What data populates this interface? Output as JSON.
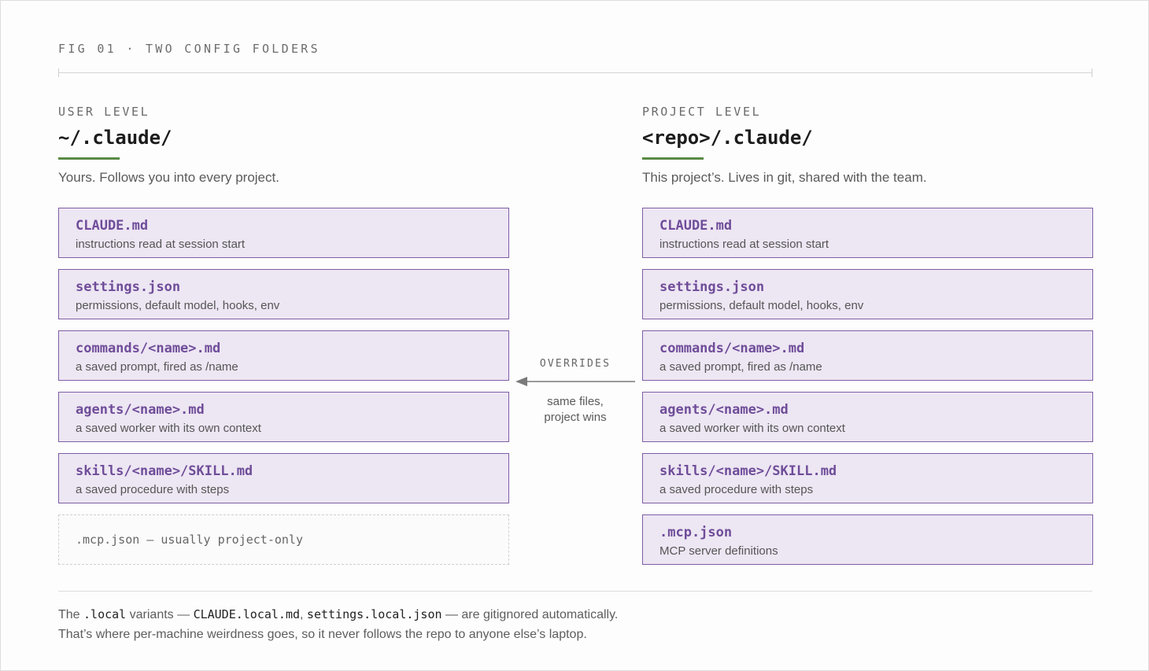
{
  "header": {
    "title": "FIG 01 · TWO CONFIG FOLDERS"
  },
  "user": {
    "label": "USER LEVEL",
    "path": "~/.claude/",
    "description": "Yours. Follows you into every project.",
    "files": [
      {
        "name": "CLAUDE.md",
        "desc": "instructions read at session start"
      },
      {
        "name": "settings.json",
        "desc": "permissions, default model, hooks, env"
      },
      {
        "name": "commands/<name>.md",
        "desc": "a saved prompt, fired as /name"
      },
      {
        "name": "agents/<name>.md",
        "desc": "a saved worker with its own context"
      },
      {
        "name": "skills/<name>/SKILL.md",
        "desc": "a saved procedure with steps"
      }
    ],
    "placeholder": ".mcp.json — usually project-only"
  },
  "project": {
    "label": "PROJECT LEVEL",
    "path": "<repo>/.claude/",
    "description": "This project’s. Lives in git, shared with the team.",
    "files": [
      {
        "name": "CLAUDE.md",
        "desc": "instructions read at session start"
      },
      {
        "name": "settings.json",
        "desc": "permissions, default model, hooks, env"
      },
      {
        "name": "commands/<name>.md",
        "desc": "a saved prompt, fired as /name"
      },
      {
        "name": "agents/<name>.md",
        "desc": "a saved worker with its own context"
      },
      {
        "name": "skills/<name>/SKILL.md",
        "desc": "a saved procedure with steps"
      },
      {
        "name": ".mcp.json",
        "desc": "MCP server definitions"
      }
    ]
  },
  "relation": {
    "label": "OVERRIDES",
    "note_line1": "same files,",
    "note_line2": "project wins"
  },
  "footer": {
    "line1": {
      "t1": "The ",
      "c1": ".local",
      "t2": " variants — ",
      "c2": "CLAUDE.local.md",
      "t3": ", ",
      "c3": "settings.local.json",
      "t4": " — are gitignored automatically."
    },
    "line2": "That’s where per-machine weirdness goes, so it never follows the repo to anyone else’s laptop."
  },
  "colors": {
    "card_fill": "#ede6f3",
    "card_border": "#7e5ea6",
    "file_name": "#6f4d99",
    "accent_underline": "#5a8a45"
  }
}
